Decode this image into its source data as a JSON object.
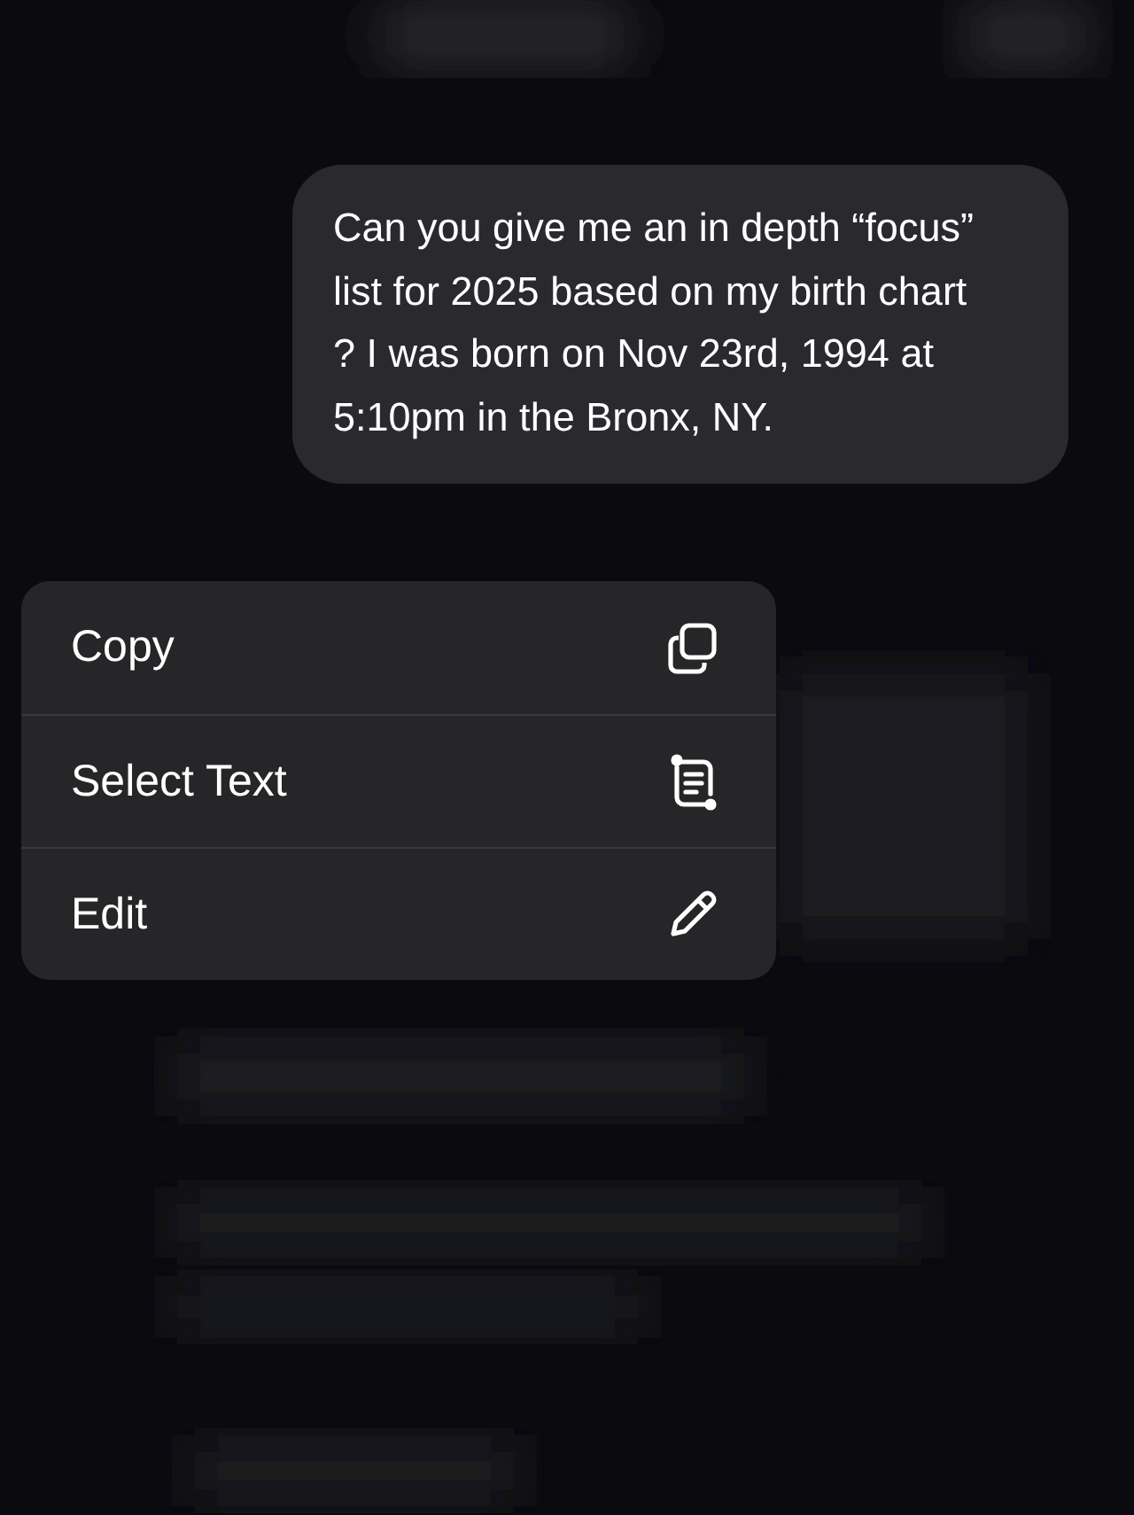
{
  "message": {
    "text": "Can you give me an in depth “focus” list for 2025 based on my birth chart ? I was born on Nov 23rd, 1994 at 5:10pm in the Bronx, NY."
  },
  "context_menu": {
    "items": [
      {
        "label": "Copy",
        "kind": "copy"
      },
      {
        "label": "Select Text",
        "kind": "select"
      },
      {
        "label": "Edit",
        "kind": "edit"
      }
    ]
  }
}
